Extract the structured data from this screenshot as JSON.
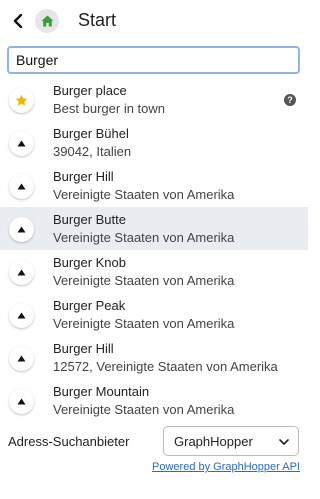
{
  "header": {
    "back_icon": "chevron-left-icon",
    "home_icon": "home-icon",
    "title": "Start"
  },
  "search": {
    "value": "Burger",
    "placeholder": ""
  },
  "results": [
    {
      "icon": "star-icon",
      "name": "Burger place",
      "desc": "Best burger in town",
      "selected": false,
      "help": true
    },
    {
      "icon": "triangle-up-icon",
      "name": "Burger Bühel",
      "desc": "39042, Italien",
      "selected": false
    },
    {
      "icon": "triangle-up-icon",
      "name": "Burger Hill",
      "desc": "Vereinigte Staaten von Amerika",
      "selected": false
    },
    {
      "icon": "triangle-up-icon",
      "name": "Burger Butte",
      "desc": "Vereinigte Staaten von Amerika",
      "selected": true
    },
    {
      "icon": "triangle-up-icon",
      "name": "Burger Knob",
      "desc": "Vereinigte Staaten von Amerika",
      "selected": false
    },
    {
      "icon": "triangle-up-icon",
      "name": "Burger Peak",
      "desc": "Vereinigte Staaten von Amerika",
      "selected": false
    },
    {
      "icon": "triangle-up-icon",
      "name": "Burger Hill",
      "desc": "12572, Vereinigte Staaten von Amerika",
      "selected": false
    },
    {
      "icon": "triangle-up-icon",
      "name": "Burger Mountain",
      "desc": "Vereinigte Staaten von Amerika",
      "selected": false
    }
  ],
  "help_label": "?",
  "provider": {
    "label": "Adress-Suchanbieter",
    "selected": "GraphHopper"
  },
  "powered_by": "Powered by GraphHopper API",
  "colors": {
    "home_green": "#3f9a3a",
    "star_yellow": "#f4b400",
    "link_blue": "#2a6ac9",
    "selected_row": "#e9edf2",
    "input_border": "#8fb4e6"
  }
}
